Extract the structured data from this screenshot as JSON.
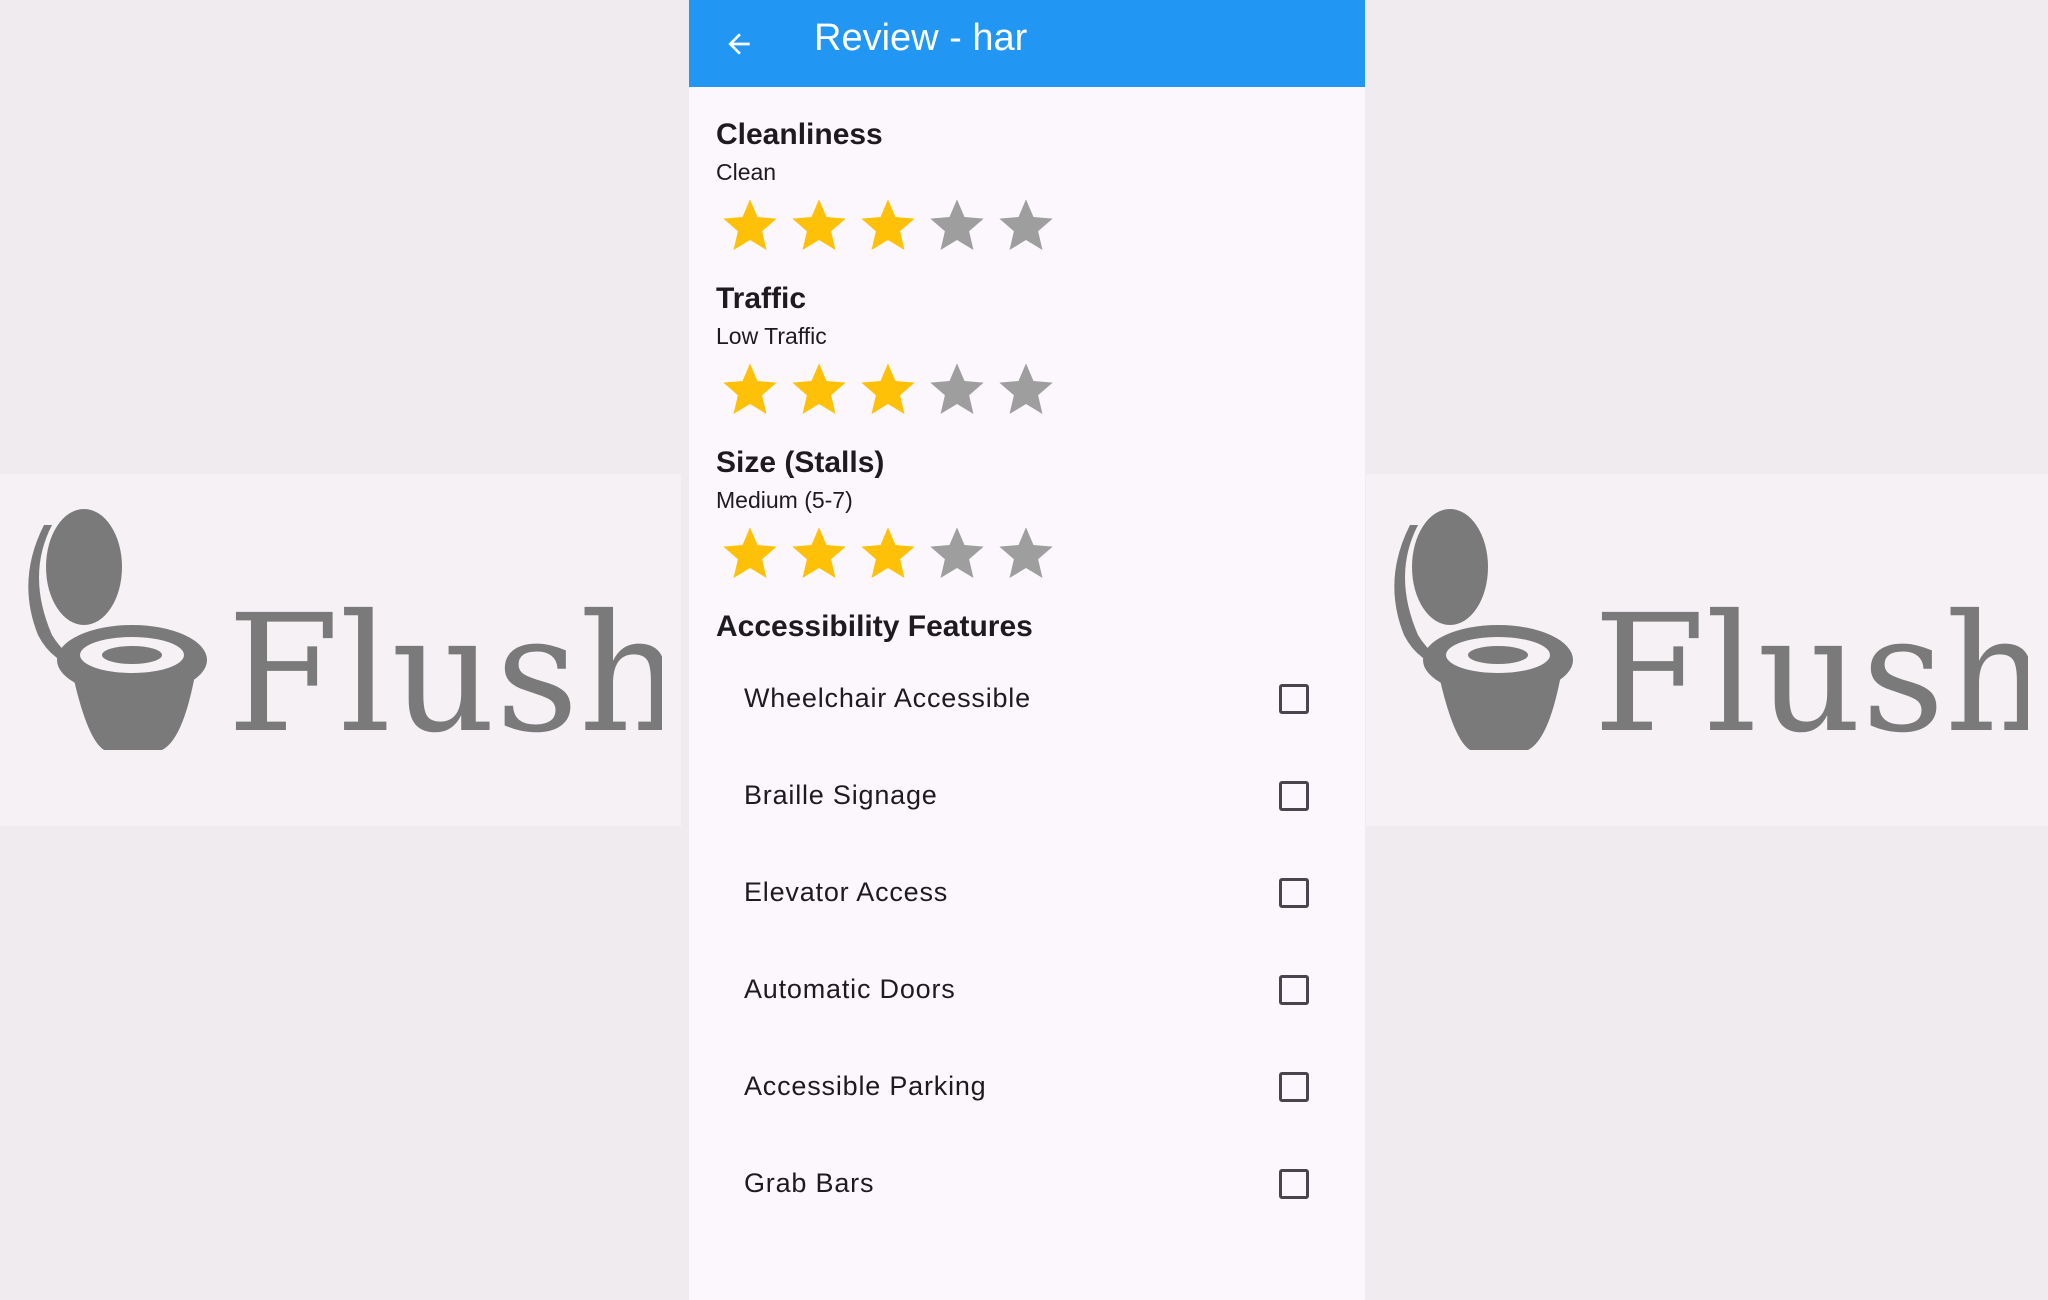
{
  "background": {
    "logo_text": "Flush",
    "logo_color": "#7a7a7a"
  },
  "appbar": {
    "title": "Review - har",
    "back_icon": "arrow-left-icon",
    "color": "#2196f3"
  },
  "ratings": [
    {
      "title": "Cleanliness",
      "value_label": "Clean",
      "stars": 3,
      "max": 5
    },
    {
      "title": "Traffic",
      "value_label": "Low Traffic",
      "stars": 3,
      "max": 5
    },
    {
      "title": "Size (Stalls)",
      "value_label": "Medium (5-7)",
      "stars": 3,
      "max": 5
    }
  ],
  "star_colors": {
    "filled": "#ffc107",
    "empty": "#9e9e9e"
  },
  "accessibility": {
    "title": "Accessibility Features",
    "items": [
      {
        "label": "Wheelchair Accessible",
        "checked": false
      },
      {
        "label": "Braille Signage",
        "checked": false
      },
      {
        "label": "Elevator Access",
        "checked": false
      },
      {
        "label": "Automatic Doors",
        "checked": false
      },
      {
        "label": "Accessible Parking",
        "checked": false
      },
      {
        "label": "Grab Bars",
        "checked": false
      }
    ]
  }
}
